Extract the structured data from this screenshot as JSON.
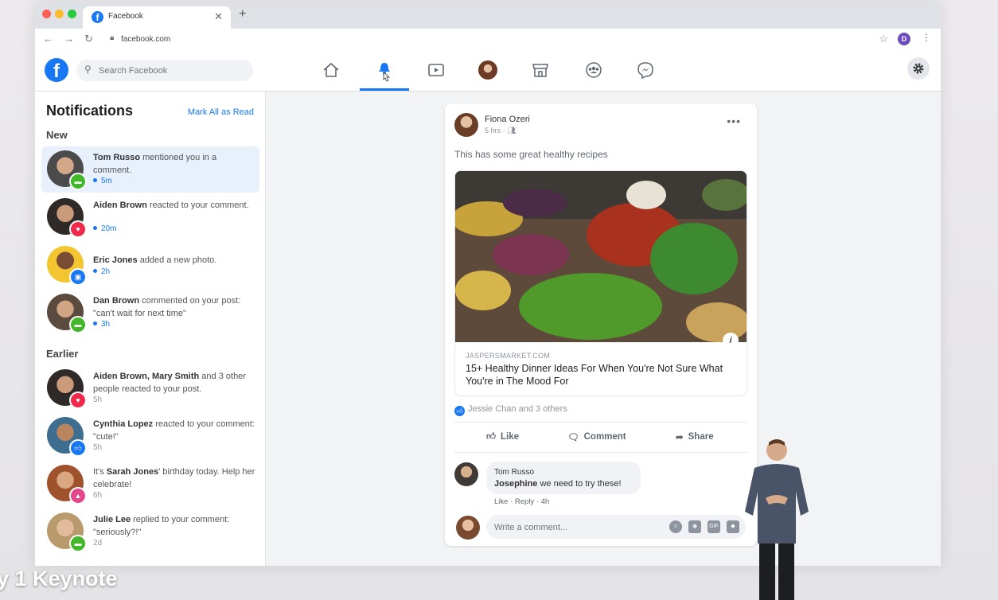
{
  "browser": {
    "tab_title": "Facebook",
    "url": "facebook.com",
    "profile_initial": "D"
  },
  "header": {
    "search_placeholder": "Search Facebook",
    "nav_icons": [
      "home-icon",
      "notifications-icon",
      "watch-icon",
      "profile-avatar",
      "marketplace-icon",
      "groups-icon",
      "messenger-icon"
    ],
    "active": "notifications-icon",
    "brand_color": "#1877f2"
  },
  "notifications": {
    "title": "Notifications",
    "mark_all": "Mark All as Read",
    "new_label": "New",
    "earlier_label": "Earlier",
    "new": [
      {
        "name": "Tom Russo",
        "text": " mentioned you in a comment.",
        "time": "5m",
        "badge": "comment",
        "badge_color": "#42b72a"
      },
      {
        "name": "Aiden Brown",
        "text": " reacted to your comment.",
        "time": "20m",
        "badge": "love",
        "badge_color": "#f02849"
      },
      {
        "name": "Eric Jones",
        "text": " added a new photo.",
        "time": "2h",
        "badge": "photo",
        "badge_color": "#1877f2"
      },
      {
        "name": "Dan Brown",
        "text": " commented on your post: \"can't wait for next time\"",
        "time": "3h",
        "badge": "comment",
        "badge_color": "#42b72a"
      }
    ],
    "earlier": [
      {
        "name": "Aiden Brown, Mary Smith",
        "text": " and 3 other people reacted to your post.",
        "time": "5h",
        "badge": "love",
        "badge_color": "#f02849"
      },
      {
        "name": "Cynthia Lopez",
        "text": " reacted to your comment: \"cute!\"",
        "time": "5h",
        "badge": "like",
        "badge_color": "#1877f2"
      },
      {
        "name_prefix": "It's ",
        "name": "Sarah Jones",
        "text": "' birthday today. Help her celebrate!",
        "time": "6h",
        "badge": "birthday",
        "badge_color": "#e4478a"
      },
      {
        "name": "Julie Lee",
        "text": " replied to your comment: \"seriously?!\"",
        "time": "2d",
        "badge": "comment",
        "badge_color": "#42b72a"
      }
    ]
  },
  "post": {
    "author": "Fiona Ozeri",
    "meta": "5 hrs · ",
    "text": "This has some great healthy recipes",
    "link_domain": "JASPERSMARKET.COM",
    "link_title": "15+ Healthy Dinner Ideas For When You're Not Sure What You're in The Mood For",
    "reactions": "Jessie Chan and 3 others",
    "actions": {
      "like": "Like",
      "comment": "Comment",
      "share": "Share"
    },
    "comment": {
      "author": "Tom Russo",
      "mention": "Josephine",
      "text": " we need to try these!",
      "like": "Like",
      "reply": "Reply",
      "time": "4h"
    },
    "write_placeholder": "Write a comment..."
  },
  "overlay": {
    "caption": "y 1 Keynote"
  }
}
